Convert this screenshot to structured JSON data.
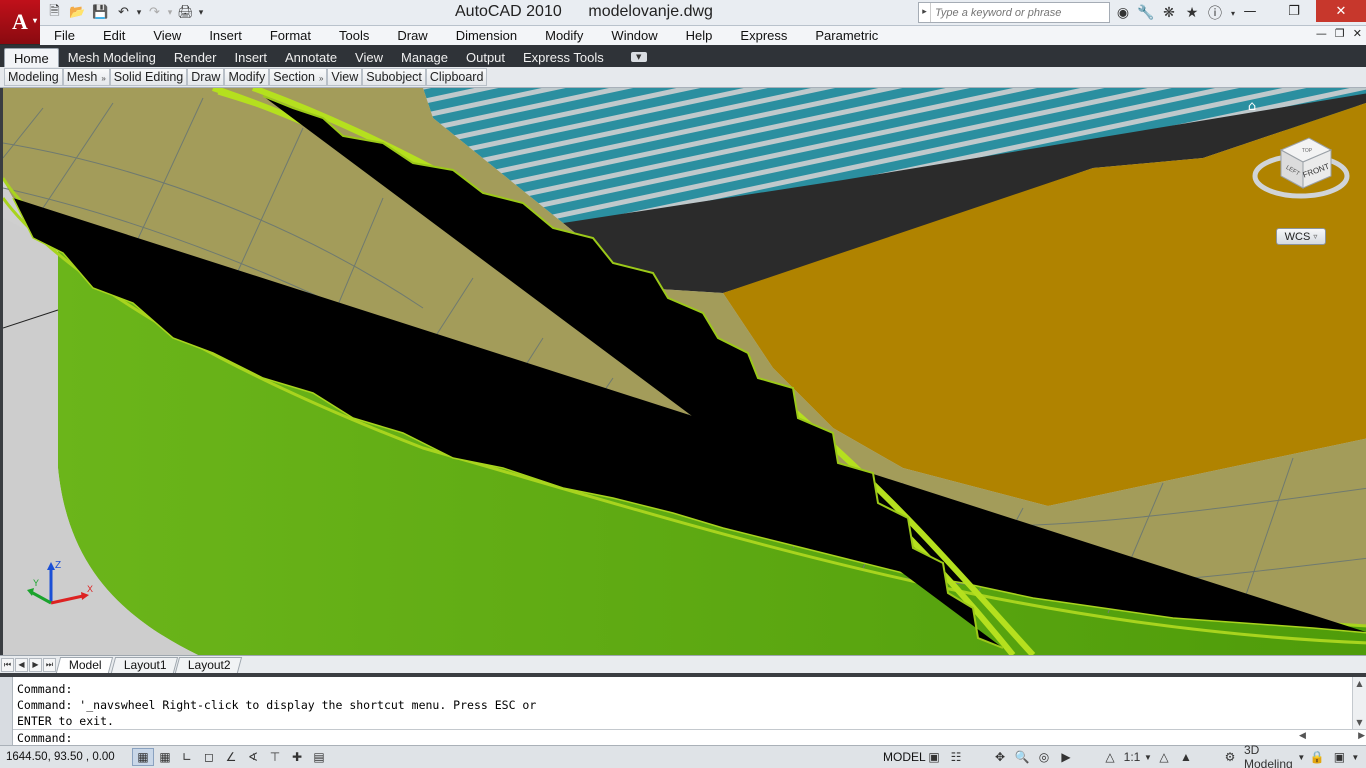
{
  "app": {
    "title": "AutoCAD 2010",
    "document": "modelovanje.dwg",
    "logo_letter": "A"
  },
  "quick_access": [
    "new-icon",
    "open-icon",
    "save-icon",
    "undo-icon",
    "redo-icon",
    "plot-icon"
  ],
  "search": {
    "placeholder": "Type a keyword or phrase"
  },
  "menu": {
    "items": [
      "File",
      "Edit",
      "View",
      "Insert",
      "Format",
      "Tools",
      "Draw",
      "Dimension",
      "Modify",
      "Window",
      "Help",
      "Express",
      "Parametric"
    ]
  },
  "ribbon": {
    "tabs": [
      "Home",
      "Mesh Modeling",
      "Render",
      "Insert",
      "Annotate",
      "View",
      "Manage",
      "Output",
      "Express Tools"
    ],
    "active_tab": "Home",
    "panels": [
      "Modeling",
      "Mesh",
      "Solid Editing",
      "Draw",
      "Modify",
      "Section",
      "View",
      "Subobject",
      "Clipboard"
    ]
  },
  "viewport": {
    "viewcube_face": "FRONT",
    "viewcube_side": "LEFT",
    "viewcube_top": "TOP",
    "ucs_menu": "WCS",
    "axis_x": "X",
    "axis_y": "Y",
    "axis_z": "Z"
  },
  "layouts": {
    "tabs": [
      "Model",
      "Layout1",
      "Layout2"
    ],
    "active": "Model"
  },
  "command": {
    "history": "Command:\nCommand: '_navswheel Right-click to display the shortcut menu. Press ESC or\nENTER to exit.",
    "prompt": "Command:"
  },
  "status": {
    "coordinates": "1644.50, 93.50 , 0.00",
    "model_label": "MODEL",
    "annotation_scale": "1:1",
    "workspace": "3D Modeling"
  },
  "colors": {
    "roof_panel": "#a39c5a",
    "truss": "#a8d41e",
    "wall": "#57a30d",
    "field": "#b08300",
    "stands": "#2b8fa0"
  }
}
